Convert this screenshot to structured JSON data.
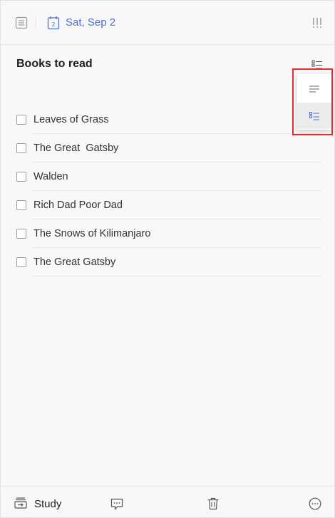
{
  "header": {
    "date": "Sat, Sep 2",
    "calendar_day": "2",
    "accent_color": "#4a6fd6"
  },
  "task": {
    "title": "Books to read",
    "items": [
      {
        "label": "Leaves of Grass",
        "checked": false
      },
      {
        "label": "The Great  Gatsby",
        "checked": false
      },
      {
        "label": "Walden",
        "checked": false
      },
      {
        "label": "Rich Dad Poor Dad",
        "checked": false
      },
      {
        "label": "The Snows of Kilimanjaro",
        "checked": false
      },
      {
        "label": "The Great Gatsby",
        "checked": false
      }
    ]
  },
  "view_menu": {
    "options": [
      "text-mode-icon",
      "checklist-mode-icon"
    ],
    "selected": "checklist-mode-icon",
    "highlight_color": "#e2302f"
  },
  "footer": {
    "list_name": "Study"
  }
}
